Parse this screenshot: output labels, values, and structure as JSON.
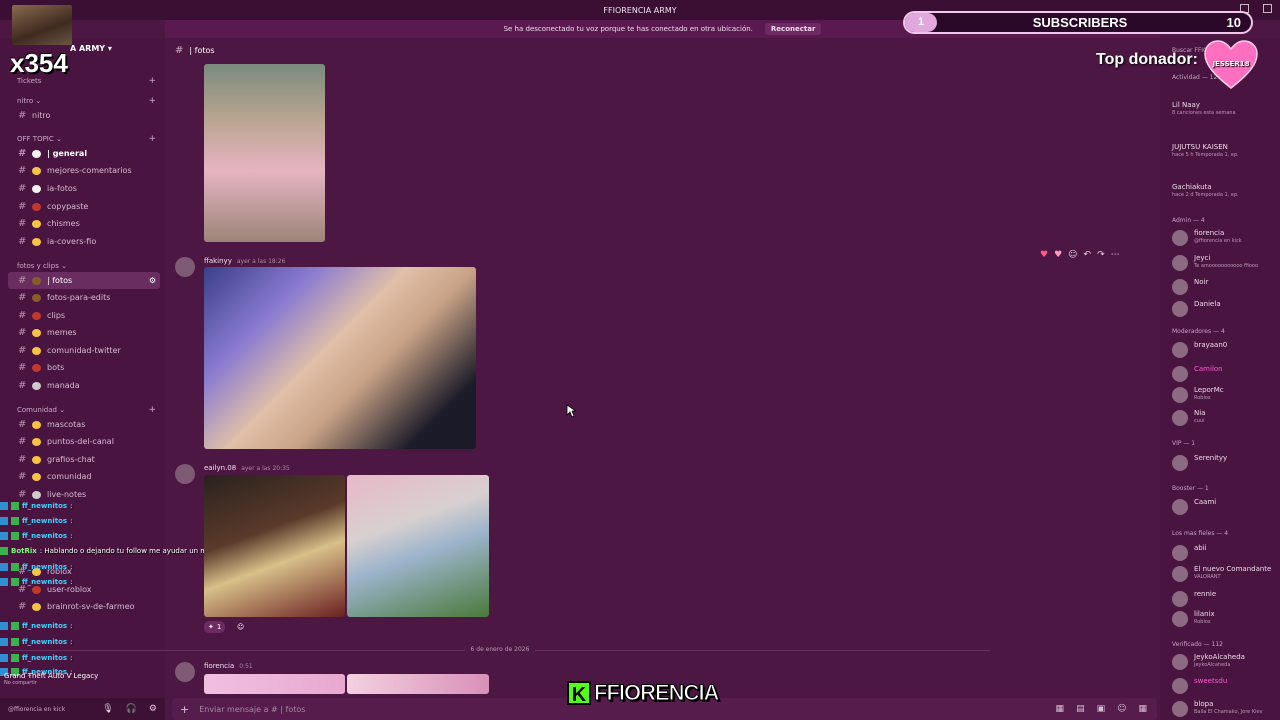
{
  "window": {
    "title": "FFIORENCIA ARMY"
  },
  "notice": {
    "text": "Se ha desconectado tu voz porque te has conectado en otra ubicación.",
    "button": "Reconectar"
  },
  "server": {
    "name": "A ARMY"
  },
  "overlay": {
    "multiplier": "x354",
    "subs_left": "1",
    "subs_label": "SUBSCRIBERS",
    "subs_right": "10",
    "top_donor_label": "Top donador:",
    "top_donor_name": "JESSER18",
    "kick_name": "FFIORENCIA"
  },
  "categories": [
    {
      "label": "Tickets"
    },
    {
      "label": "nitro"
    },
    {
      "label": "OFF TOPIC"
    },
    {
      "label": "fotos y clips"
    },
    {
      "label": "Comunidad"
    }
  ],
  "channels": [
    {
      "label": "nitro",
      "color": ""
    },
    {
      "label": "| general",
      "color": "#f2f2f2"
    },
    {
      "label": "mejores-comentarios",
      "color": "#f5c542"
    },
    {
      "label": "ia-fotos",
      "color": "#f2f2f2"
    },
    {
      "label": "copypaste",
      "color": "#c0392b"
    },
    {
      "label": "chismes",
      "color": "#f5c542"
    },
    {
      "label": "ia-covers-fio",
      "color": "#f5c542"
    },
    {
      "label": "| fotos",
      "color": "#8b5a2b"
    },
    {
      "label": "fotos-para-edits",
      "color": "#8b5a2b"
    },
    {
      "label": "clips",
      "color": "#c0392b"
    },
    {
      "label": "memes",
      "color": "#f5c542"
    },
    {
      "label": "comunidad-twitter",
      "color": "#f5c542"
    },
    {
      "label": "bots",
      "color": "#c0392b"
    },
    {
      "label": "manada",
      "color": "#cccccc"
    },
    {
      "label": "mascotas",
      "color": "#f5c542"
    },
    {
      "label": "puntos-del-canal",
      "color": "#f5c542"
    },
    {
      "label": "grafios-chat",
      "color": "#f5c542"
    },
    {
      "label": "comunidad",
      "color": "#f5c542"
    },
    {
      "label": "live-notes",
      "color": "#cccccc"
    },
    {
      "label": "roblox",
      "color": "#f5c542"
    },
    {
      "label": "user-roblox",
      "color": "#c0392b"
    },
    {
      "label": "brainrot-sv-de-farmeo",
      "color": "#f5c542"
    }
  ],
  "channel_header": {
    "name": "| fotos"
  },
  "messages": [
    {
      "author": "ffakinyy",
      "time": "ayer a las 18:26"
    },
    {
      "author": "eailyn.08",
      "time": "ayer a las 20:35",
      "reaction": "1"
    },
    {
      "author": "fiorencia",
      "time": "0:51"
    }
  ],
  "date_divider": "6 de enero de 2026",
  "composer": {
    "placeholder": "Enviar mensaje a # | fotos"
  },
  "members_panel": {
    "search": "Buscar FFIO",
    "activity_label": "Actividad — 12",
    "activities": [
      {
        "name": "Lil Naay",
        "status": "8 canciones esta semana"
      },
      {
        "name": "JUJUTSU KAISEN",
        "status": "hace 5 h  Temporada 1, ep."
      },
      {
        "name": "Gachiakuta",
        "status": "hace 2 d  Temporada 1, ep."
      }
    ],
    "groups": [
      {
        "label": "Admin — 4",
        "members": [
          {
            "name": "fiorencia",
            "status": "@ffiorencia en kick"
          },
          {
            "name": "Jeyci",
            "status": "Te amooooooooooo ffiooo"
          },
          {
            "name": "Noir",
            "status": ""
          },
          {
            "name": "Daniela",
            "status": ""
          }
        ]
      },
      {
        "label": "Moderadores — 4",
        "members": [
          {
            "name": "brayaan0",
            "status": ""
          },
          {
            "name": "Camilon",
            "status": ""
          },
          {
            "name": "LeporMc",
            "status": "Roblox"
          },
          {
            "name": "Nia",
            "status": "cuui"
          }
        ]
      },
      {
        "label": "VIP — 1",
        "members": [
          {
            "name": "Serenityy",
            "status": ""
          }
        ]
      },
      {
        "label": "Booster — 1",
        "members": [
          {
            "name": "Caami",
            "status": ""
          }
        ]
      },
      {
        "label": "Los mas fieles — 4",
        "members": [
          {
            "name": "abii",
            "status": ""
          },
          {
            "name": "El nuevo Comandante",
            "status": "VALORANT"
          },
          {
            "name": "rennie",
            "status": ""
          },
          {
            "name": "lilanix",
            "status": "Roblox"
          }
        ]
      },
      {
        "label": "Verificado — 112",
        "members": [
          {
            "name": "JeykoAlcaheda",
            "status": "JeykoAlcaheda"
          },
          {
            "name": "sweetsdu",
            "status": ""
          },
          {
            "name": "blopa",
            "status": "Baila El Chamako, Jore Kiev"
          }
        ]
      }
    ]
  },
  "stream_chat": {
    "lines": [
      {
        "user": "ff_newnitos",
        "text": ":"
      },
      {
        "user": "ff_newnitos",
        "text": ":"
      },
      {
        "user": "ff_newnitos",
        "text": ":"
      },
      {
        "user": "BotRix",
        "text": ": Hablando o dejando tu follow me ayudar un monton"
      },
      {
        "user": "ff_newnitos",
        "text": ":"
      },
      {
        "user": "ff_newnitos",
        "text": ":"
      },
      {
        "user": "ff_newnitos",
        "text": ":"
      },
      {
        "user": "ff_newnitos",
        "text": ":"
      },
      {
        "user": "ff_newnitos",
        "text": ":"
      },
      {
        "user": "ff_newnitos",
        "text": ":"
      }
    ]
  },
  "user_panel": {
    "game": "Grand Theft Auto V Legacy",
    "sub": "No compartir",
    "handle": "@ffiorencia en kick"
  }
}
